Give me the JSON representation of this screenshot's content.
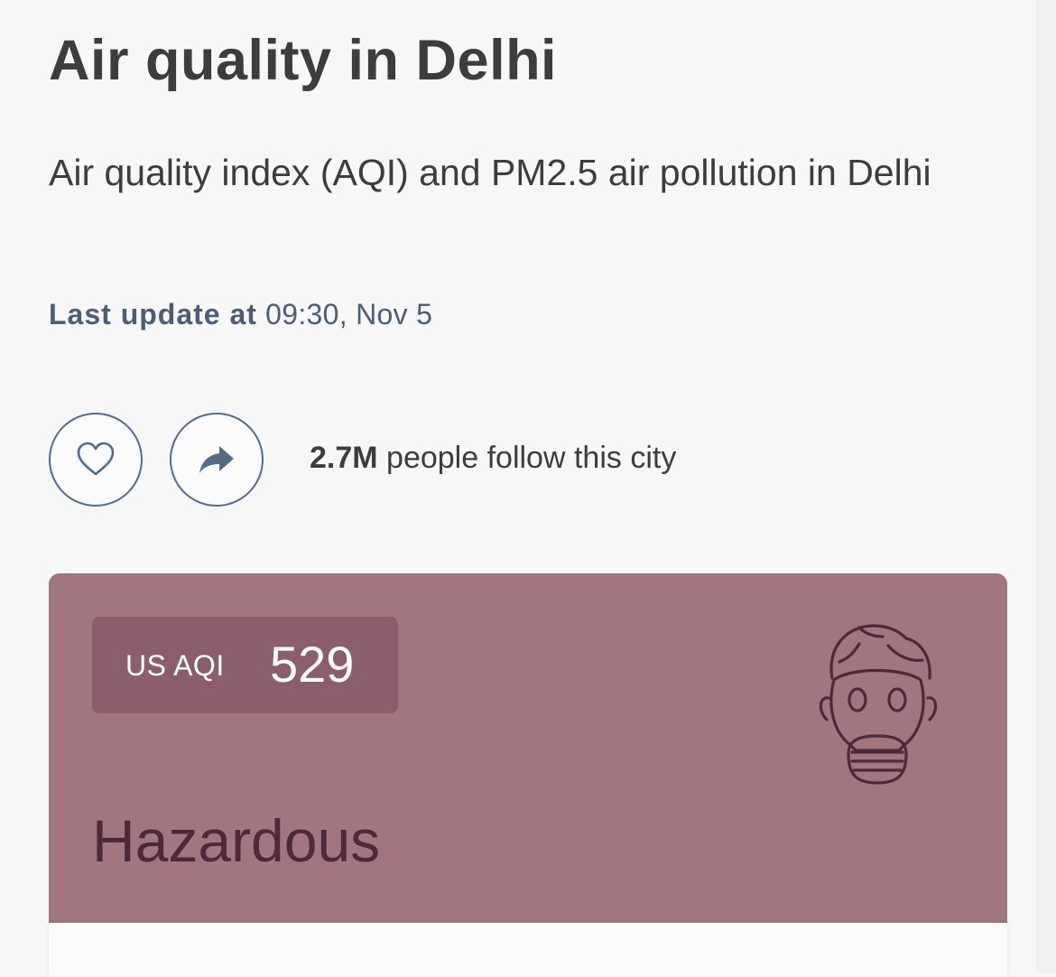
{
  "header": {
    "title": "Air quality in Delhi",
    "subtitle": "Air quality index (AQI) and PM2.5 air pollution in Delhi",
    "last_update_label": "Last update at",
    "last_update_value": "09:30, Nov 5"
  },
  "actions": {
    "follow_icon": "heart-icon",
    "share_icon": "share-icon",
    "followers_count": "2.7M",
    "followers_text": "people follow this city"
  },
  "aqi": {
    "label": "US AQI",
    "value": "529",
    "status": "Hazardous",
    "icon": "gas-mask-icon",
    "colors": {
      "card": "#a07680",
      "badge": "#8a5e6b",
      "status_text": "#4d2a39"
    }
  }
}
